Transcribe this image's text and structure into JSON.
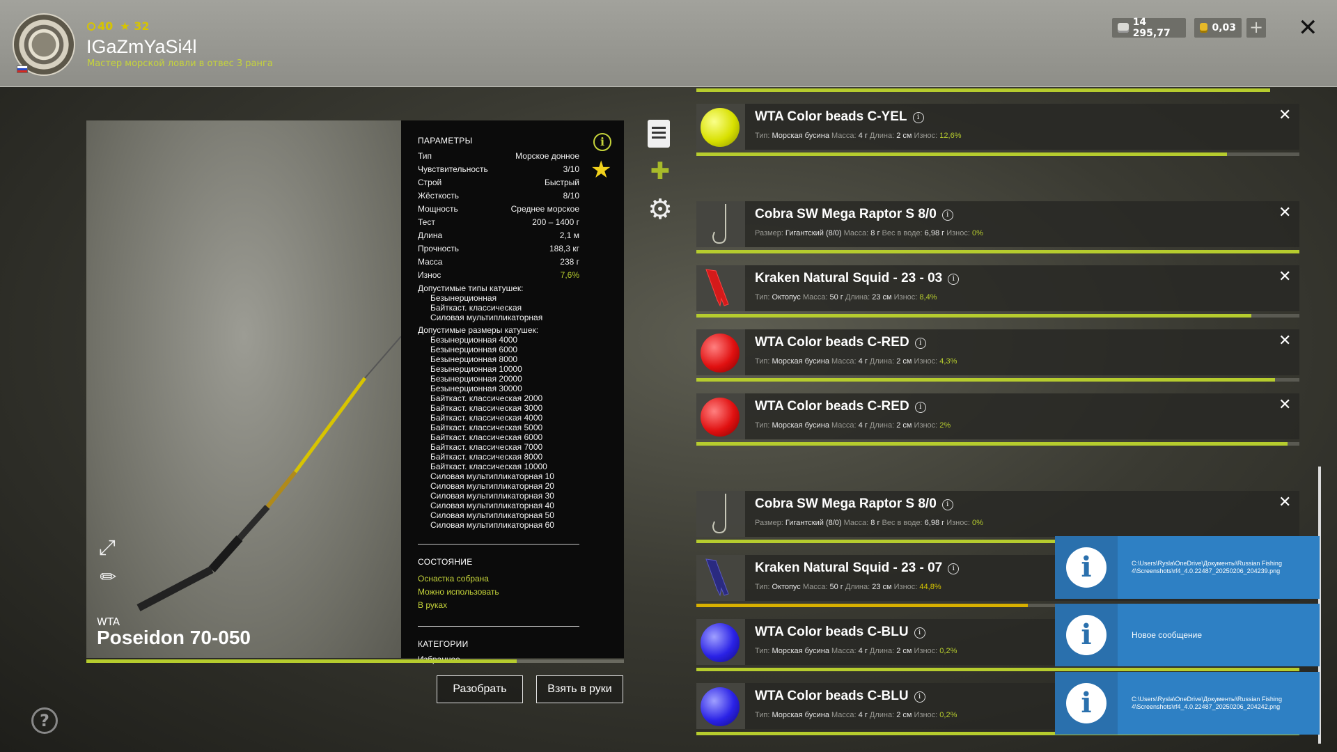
{
  "header": {
    "level": "40",
    "stars": "32",
    "username": "IGaZmYaSi4l",
    "rank": "Мастер морской ловли в отвес 3 ранга",
    "silver": "14 295,77",
    "gold": "0,03",
    "plus": "+",
    "close": "✕"
  },
  "rod": {
    "brand": "WTA",
    "name": "Poseidon 70-050",
    "condition_progress": 0.8
  },
  "params": {
    "title": "ПАРАМЕТРЫ",
    "rows": [
      {
        "label": "Тип",
        "value": "Морское донное"
      },
      {
        "label": "Чувствительность",
        "value": "3/10"
      },
      {
        "label": "Строй",
        "value": "Быстрый"
      },
      {
        "label": "Жёсткость",
        "value": "8/10"
      },
      {
        "label": "Мощность",
        "value": "Среднее морское"
      },
      {
        "label": "Тест",
        "value": "200 – 1400 г"
      },
      {
        "label": "Длина",
        "value": "2,1 м"
      },
      {
        "label": "Прочность",
        "value": "188,3 кг"
      },
      {
        "label": "Масса",
        "value": "238 г"
      },
      {
        "label": "Износ",
        "value": "7,6%"
      }
    ],
    "reel_types_label": "Допустимые типы катушек:",
    "reel_types": [
      "Безынерционная",
      "Байткаст. классическая",
      "Силовая мультипликаторная"
    ],
    "reel_sizes_label": "Допустимые размеры катушек:",
    "reel_sizes": [
      "Безынерционная 4000",
      "Безынерционная 6000",
      "Безынерционная 8000",
      "Безынерционная 10000",
      "Безынерционная 20000",
      "Безынерционная 30000",
      "Байткаст. классическая 2000",
      "Байткаст. классическая 3000",
      "Байткаст. классическая 4000",
      "Байткаст. классическая 5000",
      "Байткаст. классическая 6000",
      "Байткаст. классическая 7000",
      "Байткаст. классическая 8000",
      "Байткаст. классическая 10000",
      "Силовая мультипликаторная 10",
      "Силовая мультипликаторная 20",
      "Силовая мультипликаторная 30",
      "Силовая мультипликаторная 40",
      "Силовая мультипликаторная 50",
      "Силовая мультипликаторная 60"
    ],
    "state_title": "СОСТОЯНИЕ",
    "state_items": [
      "Оснастка собрана",
      "Можно использовать",
      "В руках"
    ],
    "categories_title": "КАТЕГОРИИ",
    "categories": [
      "Избранное"
    ]
  },
  "buttons": {
    "disassemble": "Разобрать",
    "take": "Взять в руки"
  },
  "items": [
    {
      "name": "WTA Color beads C-YEL",
      "kind": "bead",
      "color": "yel",
      "desc": [
        [
          "Тип:",
          "Морская бусина"
        ],
        [
          "Масса:",
          "4 г"
        ],
        [
          "Длина:",
          "2 см"
        ]
      ],
      "wear_label": "Износ:",
      "wear": "12,6%",
      "progress": 0.88
    },
    {
      "name": "Cobra SW Mega Raptor S 8/0",
      "kind": "hook",
      "desc": [
        [
          "Размер:",
          "Гигантский (8/0)"
        ],
        [
          "Масса:",
          "8 г"
        ],
        [
          "Вес в воде:",
          "6,98 г"
        ]
      ],
      "wear_label": "Износ:",
      "wear": "0%",
      "progress": 1.0
    },
    {
      "name": "Kraken Natural Squid - 23 - 03",
      "kind": "squid-red",
      "desc": [
        [
          "Тип:",
          "Октопус"
        ],
        [
          "Масса:",
          "50 г"
        ],
        [
          "Длина:",
          "23 см"
        ]
      ],
      "wear_label": "Износ:",
      "wear": "8,4%",
      "progress": 0.92
    },
    {
      "name": "WTA Color beads C-RED",
      "kind": "bead",
      "color": "red",
      "desc": [
        [
          "Тип:",
          "Морская бусина"
        ],
        [
          "Масса:",
          "4 г"
        ],
        [
          "Длина:",
          "2 см"
        ]
      ],
      "wear_label": "Износ:",
      "wear": "4,3%",
      "progress": 0.96
    },
    {
      "name": "WTA Color beads C-RED",
      "kind": "bead",
      "color": "red",
      "desc": [
        [
          "Тип:",
          "Морская бусина"
        ],
        [
          "Масса:",
          "4 г"
        ],
        [
          "Длина:",
          "2 см"
        ]
      ],
      "wear_label": "Износ:",
      "wear": "2%",
      "progress": 0.98
    },
    {
      "name": "Cobra SW Mega Raptor S 8/0",
      "kind": "hook",
      "desc": [
        [
          "Размер:",
          "Гигантский (8/0)"
        ],
        [
          "Масса:",
          "8 г"
        ],
        [
          "Вес в воде:",
          "6,98 г"
        ]
      ],
      "wear_label": "Износ:",
      "wear": "0%",
      "progress": 1.0
    },
    {
      "name": "Kraken Natural Squid - 23 - 07",
      "kind": "squid-blue",
      "desc": [
        [
          "Тип:",
          "Октопус"
        ],
        [
          "Масса:",
          "50 г"
        ],
        [
          "Длина:",
          "23 см"
        ]
      ],
      "wear_label": "Износ:",
      "wear": "44,8%",
      "progress": 0.55,
      "warn": true
    },
    {
      "name": "WTA Color beads C-BLU",
      "kind": "bead",
      "color": "blu",
      "desc": [
        [
          "Тип:",
          "Морская бусина"
        ],
        [
          "Масса:",
          "4 г"
        ],
        [
          "Длина:",
          "2 см"
        ]
      ],
      "wear_label": "Износ:",
      "wear": "0,2%",
      "progress": 1.0
    },
    {
      "name": "WTA Color beads C-BLU",
      "kind": "bead",
      "color": "blu",
      "desc": [
        [
          "Тип:",
          "Морская бусина"
        ],
        [
          "Масса:",
          "4 г"
        ],
        [
          "Длина:",
          "2 см"
        ]
      ],
      "wear_label": "Износ:",
      "wear": "0,2%",
      "progress": 1.0
    }
  ],
  "notifications": [
    {
      "text": "C:\\Users\\Rysla\\OneDrive\\Документы\\Russian Fishing 4\\Screenshots\\rf4_4.0.22487_20250206_204239.png",
      "big": false
    },
    {
      "text": "Новое сообщение",
      "big": true
    },
    {
      "text": "C:\\Users\\Rysla\\OneDrive\\Документы\\Russian Fishing 4\\Screenshots\\rf4_4.0.22487_20250206_204242.png",
      "big": false
    }
  ],
  "icons": {
    "info": "i",
    "star": "★",
    "doc": "",
    "puzzle": "✚",
    "gear": "⚙",
    "expand": "⤢",
    "pencil": "✎",
    "help": "?"
  }
}
